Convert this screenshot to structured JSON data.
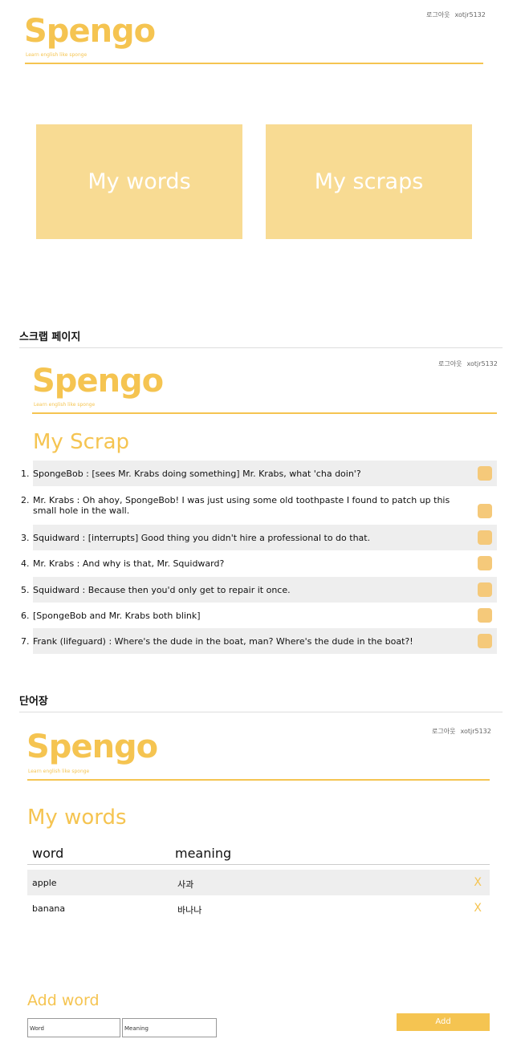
{
  "header1": {
    "brand": "Spengo",
    "tagline": "Learn english like sponge",
    "logout": "로그아웃",
    "user": "xotjr5132"
  },
  "home": {
    "tile_words": "My words",
    "tile_scraps": "My scraps"
  },
  "section_scrap": "스크랩 페이지",
  "header2": {
    "brand": "Spengo",
    "tagline": "Learn english like sponge",
    "logout": "로그아웃",
    "user": "xotjr5132"
  },
  "scrap": {
    "title": "My Scrap",
    "items": [
      {
        "num": "1.",
        "text": "SpongeBob : [sees Mr. Krabs doing something] Mr. Krabs, what 'cha doin'?"
      },
      {
        "num": "2.",
        "text": "Mr. Krabs : Oh ahoy, SpongeBob! I was just using some old toothpaste I found to patch up this small hole in the wall."
      },
      {
        "num": "3.",
        "text": "Squidward : [interrupts] Good thing you didn't hire a professional to do that."
      },
      {
        "num": "4.",
        "text": "Mr. Krabs : And why is that, Mr. Squidward?"
      },
      {
        "num": "5.",
        "text": "Squidward : Because then you'd only get to repair it once."
      },
      {
        "num": "6.",
        "text": "[SpongeBob and Mr. Krabs both blink]"
      },
      {
        "num": "7.",
        "text": "Frank (lifeguard) : Where's the dude in the boat, man? Where's the dude in the boat?!"
      }
    ]
  },
  "section_words": "단어장",
  "header3": {
    "brand": "Spengo",
    "tagline": "Learn english like sponge",
    "logout": "로그아웃",
    "user": "xotjr5132"
  },
  "words": {
    "title": "My words",
    "col_word": "word",
    "col_meaning": "meaning",
    "rows": [
      {
        "word": "apple",
        "meaning": "사과",
        "delete": "X"
      },
      {
        "word": "banana",
        "meaning": "바나나",
        "delete": "X"
      }
    ]
  },
  "add": {
    "title": "Add word",
    "word_placeholder": "Word",
    "meaning_placeholder": "Meaning",
    "button": "Add"
  }
}
